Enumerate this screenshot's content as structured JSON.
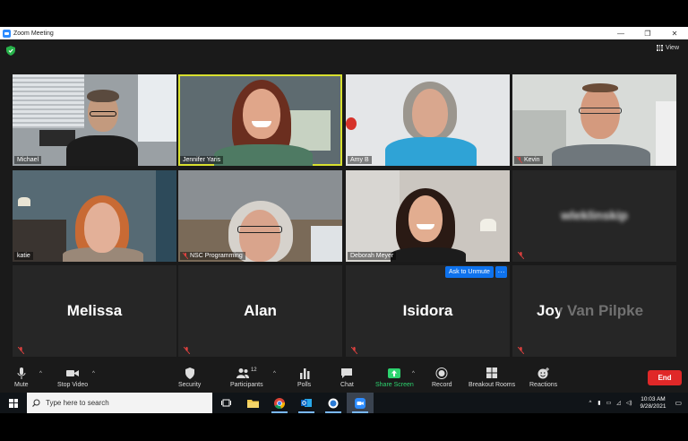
{
  "window": {
    "title": "Zoom Meeting",
    "controls": [
      "—",
      "❐",
      "✕"
    ]
  },
  "meeting": {
    "view_label": "View",
    "participants_row1": [
      {
        "name": "Michael",
        "muted": false
      },
      {
        "name": "Jennifer Yaris",
        "muted": false,
        "active_speaker": true
      },
      {
        "name": "Amy B",
        "muted": false
      },
      {
        "name": "Kevin",
        "muted": true
      }
    ],
    "participants_row2": [
      {
        "name": "katie",
        "muted": false
      },
      {
        "name": "NSC Programming",
        "muted": true
      },
      {
        "name": "Deborah Meyer",
        "muted": false
      },
      {
        "name": "wleklinskip",
        "muted": true,
        "video_off": true
      }
    ],
    "participants_row3": [
      {
        "name": "Melissa",
        "muted": true
      },
      {
        "name": "Alan",
        "muted": true
      },
      {
        "name": "Isidora",
        "muted": true
      },
      {
        "name": "Joy Van Pilpke",
        "muted": true
      }
    ],
    "ask_to_unmute_label": "Ask to Unmute",
    "more_label": "···"
  },
  "toolbar": {
    "mute": "Mute",
    "stop_video": "Stop Video",
    "security": "Security",
    "participants": "Participants",
    "participant_count": "12",
    "polls": "Polls",
    "chat": "Chat",
    "share_screen": "Share Screen",
    "record": "Record",
    "breakout_rooms": "Breakout Rooms",
    "reactions": "Reactions",
    "end": "End"
  },
  "taskbar": {
    "search_placeholder": "Type here to search",
    "time": "10:03 AM",
    "date": "9/28/2021"
  },
  "colors": {
    "active_speaker": "#d8e02f",
    "unmute_blue": "#0e72ed",
    "end_red": "#e02828",
    "share_green": "#2dd36f",
    "muted_red": "#e0413f"
  }
}
